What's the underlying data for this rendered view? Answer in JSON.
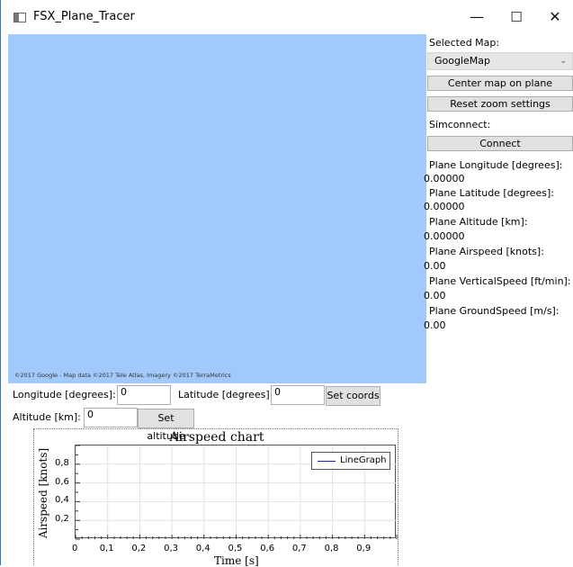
{
  "window": {
    "title": "FSX_Plane_Tracer",
    "controls": {
      "minimize": "—",
      "maximize": "☐",
      "close": "✕"
    }
  },
  "map": {
    "credit": "©2017 Google - Map data ©2017 Tele Atlas, Imagery ©2017 TerraMetrics",
    "background_color": "#a2c9fb"
  },
  "side": {
    "selected_map_label": "Selected Map:",
    "selected_map_value": "GoogleMap",
    "center_button": "Center map on plane",
    "reset_button": "Reset zoom settings",
    "simconnect_label": "Simconnect:",
    "connect_button": "Connect",
    "readouts": [
      {
        "label": "Plane Longitude [degrees]:",
        "value": "0.00000"
      },
      {
        "label": "Plane Latitude [degrees]:",
        "value": "0.00000"
      },
      {
        "label": "Plane Altitude [km]:",
        "value": "0.00000"
      },
      {
        "label": "Plane Airspeed [knots]:",
        "value": "0.00"
      },
      {
        "label": "Plane VerticalSpeed [ft/min]:",
        "value": "0.00"
      },
      {
        "label": "Plane GroundSpeed [m/s]:",
        "value": "0.00"
      }
    ]
  },
  "coords": {
    "longitude_label": "Longitude [degrees]:",
    "longitude_value": "0",
    "latitude_label": "Latitude [degrees]:",
    "latitude_value": "0",
    "set_coords_button": "Set coords",
    "altitude_label": "Altitude [km]:",
    "altitude_value": "0",
    "set_altitude_button": "Set altitude"
  },
  "chart_data": {
    "type": "line",
    "title": "Airspeed chart",
    "xlabel": "Time [s]",
    "ylabel": "Airspeed [knots]",
    "xlim": [
      0,
      1
    ],
    "ylim": [
      0,
      1
    ],
    "x_ticks": [
      "0",
      "0,1",
      "0,2",
      "0,3",
      "0,4",
      "0,5",
      "0,6",
      "0,7",
      "0,8",
      "0,9"
    ],
    "y_ticks": [
      "0,2",
      "0,4",
      "0,6",
      "0,8"
    ],
    "series": [
      {
        "name": "LineGraph",
        "values": []
      }
    ],
    "grid": true,
    "legend": "top-right",
    "line_color": "#1f1fbf"
  }
}
